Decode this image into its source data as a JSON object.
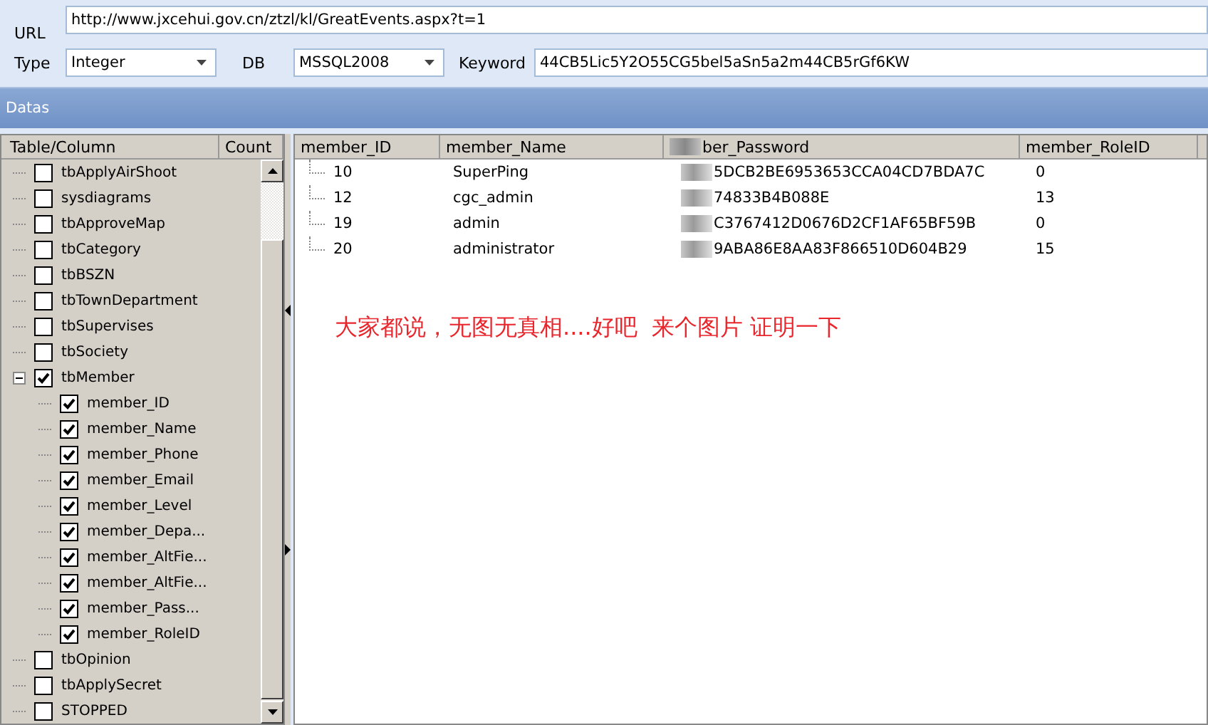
{
  "form": {
    "url_label": "URL",
    "url": "http://www.jxcehui.gov.cn/ztzl/kl/GreatEvents.aspx?t=1",
    "type_label": "Type",
    "type": "Integer",
    "db_label": "DB",
    "db": "MSSQL2008",
    "keyword_label": "Keyword",
    "keyword": "44CB5Lic5Y2O55CG5bel5aSn5a2m44CB5rGf6KW"
  },
  "panel": {
    "title": "Datas"
  },
  "tree": {
    "columns": [
      "Table/Column",
      "Count"
    ],
    "items": [
      {
        "label": "tbApplyAirShoot",
        "checked": false
      },
      {
        "label": "sysdiagrams",
        "checked": false
      },
      {
        "label": "tbApproveMap",
        "checked": false
      },
      {
        "label": "tbCategory",
        "checked": false
      },
      {
        "label": "tbBSZN",
        "checked": false
      },
      {
        "label": "tbTownDepartment",
        "checked": false
      },
      {
        "label": "tbSupervises",
        "checked": false
      },
      {
        "label": "tbSociety",
        "checked": false
      },
      {
        "label": "tbMember",
        "checked": true,
        "expanded": true,
        "children": [
          {
            "label": "member_ID",
            "checked": true
          },
          {
            "label": "member_Name",
            "checked": true
          },
          {
            "label": "member_Phone",
            "checked": true
          },
          {
            "label": "member_Email",
            "checked": true
          },
          {
            "label": "member_Level",
            "checked": true
          },
          {
            "label": "member_Depa...",
            "checked": true
          },
          {
            "label": "member_AltFie...",
            "checked": true
          },
          {
            "label": "member_AltFie...",
            "checked": true
          },
          {
            "label": "member_Pass...",
            "checked": true
          },
          {
            "label": "member_RoleID",
            "checked": true
          }
        ]
      },
      {
        "label": "tbOpinion",
        "checked": false
      },
      {
        "label": "tbApplySecret",
        "checked": false
      },
      {
        "label": "STOPPED",
        "checked": false
      }
    ]
  },
  "grid": {
    "columns": [
      {
        "label": "member_ID",
        "redacted": false
      },
      {
        "label": "member_Name",
        "redacted": false
      },
      {
        "label": "ber_Password",
        "redacted": true
      },
      {
        "label": "member_RoleID",
        "redacted": false
      }
    ],
    "rows": [
      [
        "10",
        "SuperPing",
        "5DCB2BE6953653CCA04CD7BDA7C",
        "0"
      ],
      [
        "12",
        "cgc_admin",
        "74833B4B088E",
        "13"
      ],
      [
        "19",
        "admin",
        "C3767412D0676D2CF1AF65BF59B",
        "0"
      ],
      [
        "20",
        "administrator",
        "9ABA86E8AA83F866510D604B29",
        "15"
      ]
    ]
  },
  "note": "大家都说，无图无真相....好吧  来个图片 证明一下"
}
